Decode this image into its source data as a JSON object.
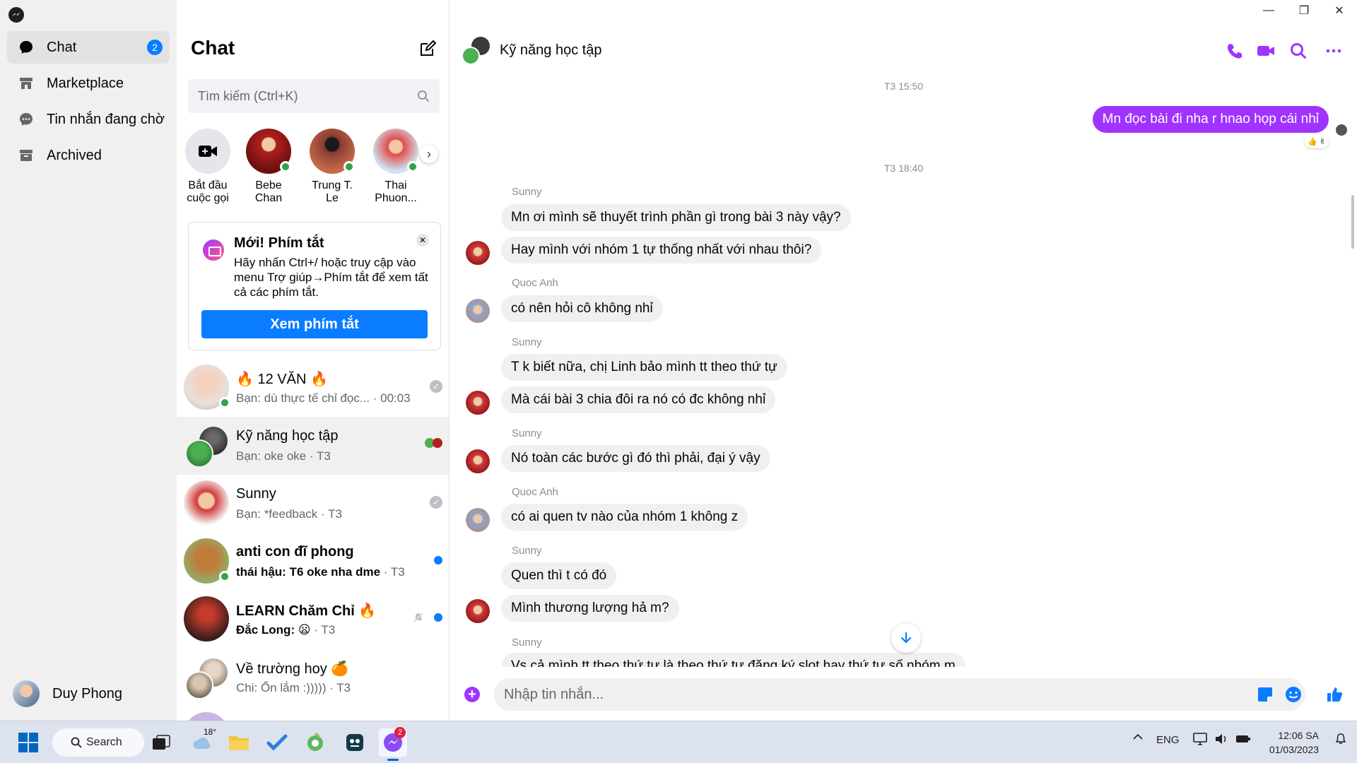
{
  "nav": {
    "items": [
      {
        "label": "Chat",
        "badge": "2"
      },
      {
        "label": "Marketplace"
      },
      {
        "label": "Tin nhắn đang chờ"
      },
      {
        "label": "Archived"
      }
    ],
    "profile_name": "Duy Phong"
  },
  "list": {
    "title": "Chat",
    "search_placeholder": "Tìm kiếm (Ctrl+K)",
    "stories": [
      {
        "label": "Bắt đầu cuộc gọi"
      },
      {
        "label": "Bebe Chan"
      },
      {
        "label": "Trung T. Le"
      },
      {
        "label": "Thai Phuon..."
      }
    ],
    "tip": {
      "title": "Mới! Phím tắt",
      "body": "Hãy nhấn Ctrl+/ hoặc truy cập vào menu Trợ giúp→Phím tắt để xem tất cả các phím tắt.",
      "button": "Xem phím tắt"
    },
    "conversations": [
      {
        "name": "🔥 12 VĂN 🔥",
        "preview": "Bạn: dù thực tế chỉ đọc...  · 00:03"
      },
      {
        "name": "Kỹ năng học tập",
        "preview": "Bạn: oke oke · T3"
      },
      {
        "name": "Sunny",
        "preview": "Bạn: *feedback · T3"
      },
      {
        "name": "anti con đĩ phong",
        "preview": "thái hậu: T6 oke nha dme",
        "time": " · T3"
      },
      {
        "name": "LEARN Chăm Chỉ 🔥",
        "preview": "Đắc Long: 😦",
        "time": " · T3"
      },
      {
        "name": "Về trường hoy 🍊",
        "preview": "Chi: Ổn lắm :))))) · T3"
      }
    ]
  },
  "chat": {
    "title": "Kỹ năng học tập",
    "timestamps": [
      "T3 15:50",
      "T3 18:40"
    ],
    "outgoing": "Mn đọc bài đi nha r hnao họp cái nhỉ",
    "reactions": "👍 ✌",
    "senders": [
      "Sunny",
      "Quoc Anh",
      "Sunny",
      "Sunny",
      "Quoc Anh",
      "Sunny",
      "Sunny"
    ],
    "messages": [
      "Mn ơi mình sẽ thuyết trình phần gì trong bài 3 này vậy?",
      "Hay mình với nhóm 1 tự thống nhất với nhau thôi?",
      "có nên hỏi cô không nhỉ",
      "T k biết nữa, chị Linh bảo mình tt theo thứ tự",
      "Mà cái bài 3 chia đôi ra nó có đc không nhỉ",
      "Nó toàn các bước gì đó thì phải, đại ý vậy",
      "có ai quen tv nào của nhóm 1 không z",
      "Quen thì t có đó",
      "Mình thương lượng hả m?",
      "Vs cả mình tt theo thứ tự là theo thứ tự đăng ký slot hay thứ tự số nhóm m"
    ],
    "composer_placeholder": "Nhập tin nhắn..."
  },
  "taskbar": {
    "search": "Search",
    "weather": "18°",
    "messenger_badge": "2",
    "lang": "ENG",
    "time": "12:06 SA",
    "date": "01/03/2023"
  },
  "colors": {
    "accent": "#a033ff",
    "blue": "#0a7cff",
    "online": "#31a24c"
  }
}
